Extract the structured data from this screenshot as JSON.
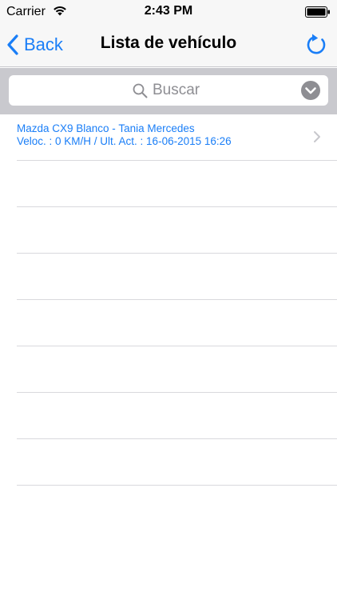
{
  "status_bar": {
    "carrier": "Carrier",
    "time": "2:43 PM"
  },
  "nav": {
    "back_label": "Back",
    "title": "Lista de vehículo"
  },
  "search": {
    "placeholder": "Buscar",
    "value": ""
  },
  "vehicles": [
    {
      "name": "Mazda CX9 Blanco - Tania Mercedes",
      "detail": "Veloc. : 0 KM/H  /  Ult. Act. : 16-06-2015 16:26"
    }
  ],
  "colors": {
    "accent": "#1a7ef7",
    "nav_background": "#f7f7f7",
    "search_background": "#c9c9ce",
    "separator": "#d9d9dd"
  },
  "icons": {
    "wifi": "wifi-icon",
    "battery": "battery-icon",
    "back": "chevron-left-icon",
    "refresh": "refresh-icon",
    "search": "search-icon",
    "scope": "chevron-down-circle-icon",
    "row_disclosure": "chevron-right-icon"
  }
}
